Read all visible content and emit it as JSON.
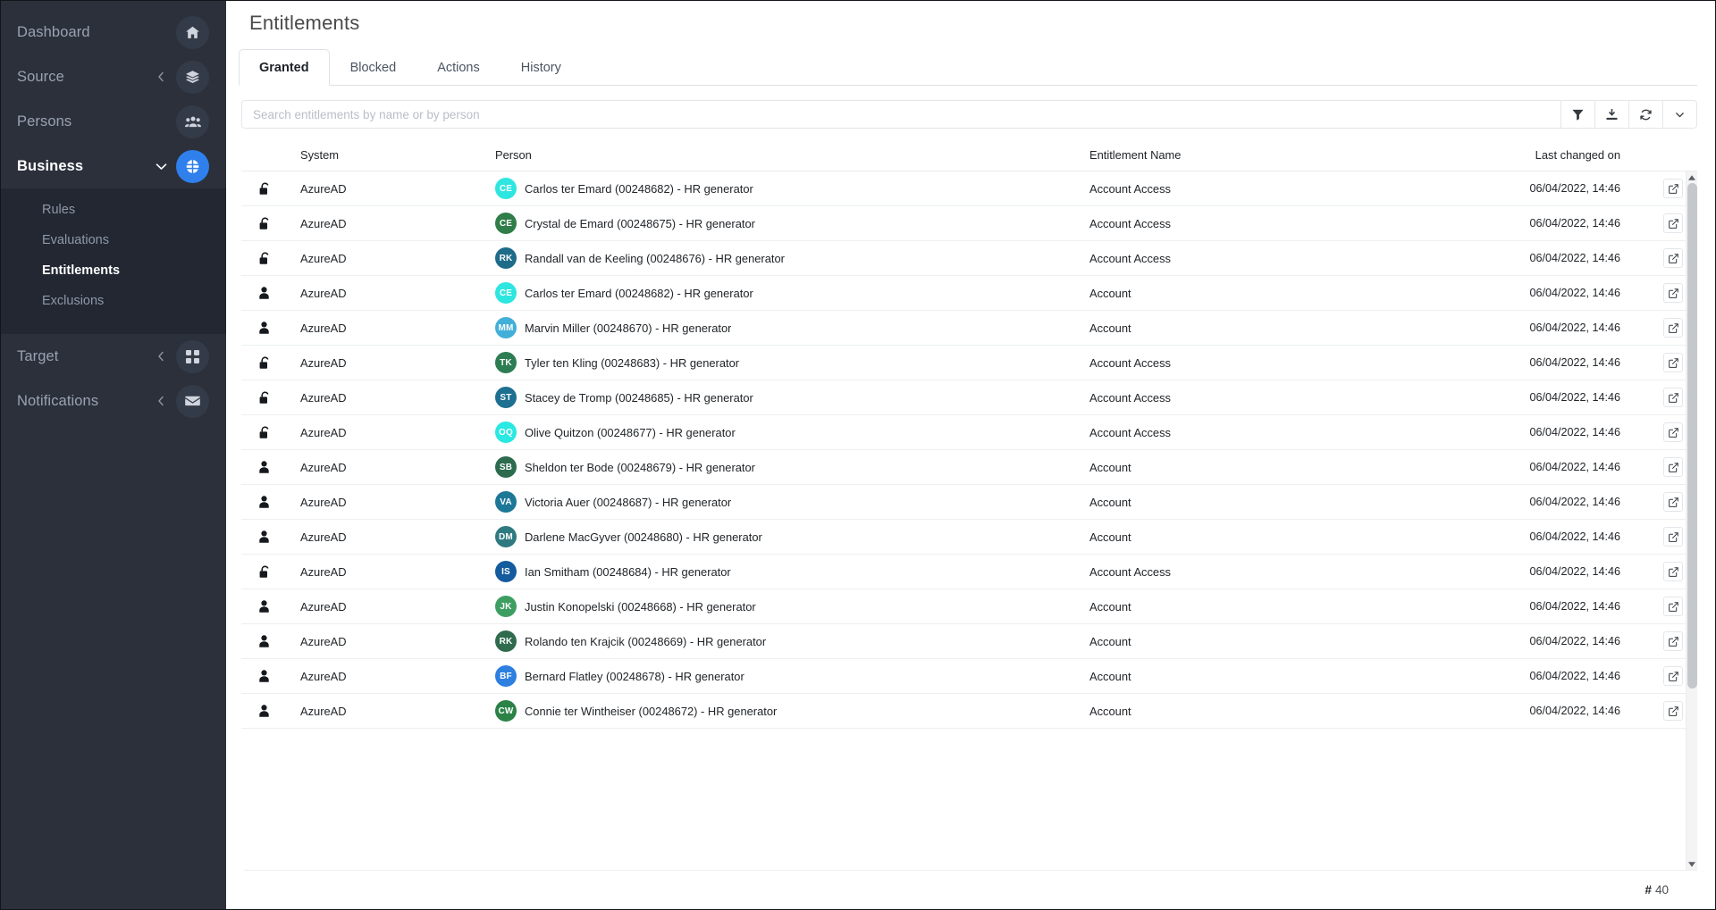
{
  "sidebar": {
    "items": [
      {
        "label": "Dashboard",
        "icon": "home-icon",
        "chevron": null,
        "active": false,
        "accent": false
      },
      {
        "label": "Source",
        "icon": "layers-icon",
        "chevron": "left",
        "active": false,
        "accent": false
      },
      {
        "label": "Persons",
        "icon": "users-icon",
        "chevron": null,
        "active": false,
        "accent": false
      },
      {
        "label": "Business",
        "icon": "business-icon",
        "chevron": "down",
        "active": true,
        "accent": true
      },
      {
        "label": "Target",
        "icon": "grid-icon",
        "chevron": "left",
        "active": false,
        "accent": false
      },
      {
        "label": "Notifications",
        "icon": "envelope-icon",
        "chevron": "left",
        "active": false,
        "accent": false
      }
    ],
    "submenu": [
      {
        "label": "Rules",
        "active": false
      },
      {
        "label": "Evaluations",
        "active": false
      },
      {
        "label": "Entitlements",
        "active": true
      },
      {
        "label": "Exclusions",
        "active": false
      }
    ],
    "accent_color": "#2f80ed",
    "background_color": "#2b303b",
    "submenu_background_color": "#222732"
  },
  "header": {
    "title": "Entitlements"
  },
  "tabs": [
    {
      "label": "Granted",
      "active": true
    },
    {
      "label": "Blocked",
      "active": false
    },
    {
      "label": "Actions",
      "active": false
    },
    {
      "label": "History",
      "active": false
    }
  ],
  "search": {
    "value": "",
    "placeholder": "Search entitlements by name or by person"
  },
  "toolbar_buttons": [
    {
      "name": "filter-icon",
      "title": "Filter"
    },
    {
      "name": "download-icon",
      "title": "Export"
    },
    {
      "name": "refresh-icon",
      "title": "Refresh"
    },
    {
      "name": "chevron-down-icon",
      "title": "More"
    }
  ],
  "table": {
    "columns": [
      "",
      "System",
      "Person",
      "Entitlement Name",
      "Last changed on",
      ""
    ],
    "rows": [
      {
        "type_icon": "unlock-icon",
        "system": "AzureAD",
        "initials": "CE",
        "avatar_color": "#2ee6e0",
        "person": "Carlos ter Emard (00248682) - HR generator",
        "entitlement": "Account Access",
        "changed_on": "06/04/2022, 14:46"
      },
      {
        "type_icon": "unlock-icon",
        "system": "AzureAD",
        "initials": "CE",
        "avatar_color": "#2f7d48",
        "person": "Crystal de Emard (00248675) - HR generator",
        "entitlement": "Account Access",
        "changed_on": "06/04/2022, 14:46"
      },
      {
        "type_icon": "unlock-icon",
        "system": "AzureAD",
        "initials": "RK",
        "avatar_color": "#1f6b8a",
        "person": "Randall van de Keeling (00248676) - HR generator",
        "entitlement": "Account Access",
        "changed_on": "06/04/2022, 14:46"
      },
      {
        "type_icon": "person-icon",
        "system": "AzureAD",
        "initials": "CE",
        "avatar_color": "#2ee6e0",
        "person": "Carlos ter Emard (00248682) - HR generator",
        "entitlement": "Account",
        "changed_on": "06/04/2022, 14:46"
      },
      {
        "type_icon": "person-icon",
        "system": "AzureAD",
        "initials": "MM",
        "avatar_color": "#42afd8",
        "person": "Marvin Miller (00248670) - HR generator",
        "entitlement": "Account",
        "changed_on": "06/04/2022, 14:46"
      },
      {
        "type_icon": "unlock-icon",
        "system": "AzureAD",
        "initials": "TK",
        "avatar_color": "#2d7d52",
        "person": "Tyler ten Kling (00248683) - HR generator",
        "entitlement": "Account Access",
        "changed_on": "06/04/2022, 14:46"
      },
      {
        "type_icon": "unlock-icon",
        "system": "AzureAD",
        "initials": "ST",
        "avatar_color": "#1d7090",
        "person": "Stacey de Tromp (00248685) - HR generator",
        "entitlement": "Account Access",
        "changed_on": "06/04/2022, 14:46"
      },
      {
        "type_icon": "unlock-icon",
        "system": "AzureAD",
        "initials": "OQ",
        "avatar_color": "#2ae8e2",
        "person": "Olive Quitzon (00248677) - HR generator",
        "entitlement": "Account Access",
        "changed_on": "06/04/2022, 14:46"
      },
      {
        "type_icon": "person-icon",
        "system": "AzureAD",
        "initials": "SB",
        "avatar_color": "#2d6b4f",
        "person": "Sheldon ter Bode (00248679) - HR generator",
        "entitlement": "Account",
        "changed_on": "06/04/2022, 14:46"
      },
      {
        "type_icon": "person-icon",
        "system": "AzureAD",
        "initials": "VA",
        "avatar_color": "#1d7796",
        "person": "Victoria Auer (00248687) - HR generator",
        "entitlement": "Account",
        "changed_on": "06/04/2022, 14:46"
      },
      {
        "type_icon": "person-icon",
        "system": "AzureAD",
        "initials": "DM",
        "avatar_color": "#2f7a80",
        "person": "Darlene MacGyver (00248680) - HR generator",
        "entitlement": "Account",
        "changed_on": "06/04/2022, 14:46"
      },
      {
        "type_icon": "unlock-icon",
        "system": "AzureAD",
        "initials": "IS",
        "avatar_color": "#155c9e",
        "person": "Ian Smitham (00248684) - HR generator",
        "entitlement": "Account Access",
        "changed_on": "06/04/2022, 14:46"
      },
      {
        "type_icon": "person-icon",
        "system": "AzureAD",
        "initials": "JK",
        "avatar_color": "#3e9e62",
        "person": "Justin Konopelski (00248668) - HR generator",
        "entitlement": "Account",
        "changed_on": "06/04/2022, 14:46"
      },
      {
        "type_icon": "person-icon",
        "system": "AzureAD",
        "initials": "RK",
        "avatar_color": "#2f6b4d",
        "person": "Rolando ten Krajcik (00248669) - HR generator",
        "entitlement": "Account",
        "changed_on": "06/04/2022, 14:46"
      },
      {
        "type_icon": "person-icon",
        "system": "AzureAD",
        "initials": "BF",
        "avatar_color": "#2d7fe0",
        "person": "Bernard Flatley (00248678) - HR generator",
        "entitlement": "Account",
        "changed_on": "06/04/2022, 14:46"
      },
      {
        "type_icon": "person-icon",
        "system": "AzureAD",
        "initials": "CW",
        "avatar_color": "#2a8247",
        "person": "Connie ter Wintheiser (00248672) - HR generator",
        "entitlement": "Account",
        "changed_on": "06/04/2022, 14:46"
      }
    ]
  },
  "footer": {
    "hash": "#",
    "count": "40"
  }
}
